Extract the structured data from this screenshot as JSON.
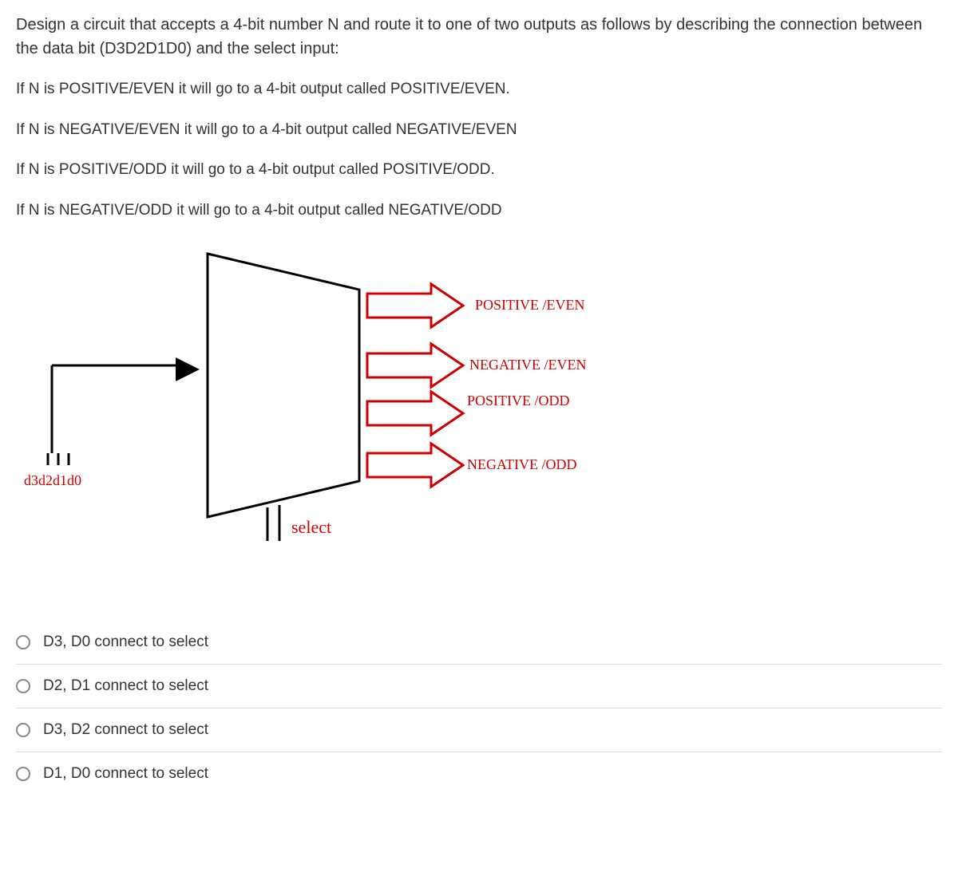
{
  "question": {
    "intro": "Design a circuit that accepts a 4-bit number N and route it to one of two outputs as follows by describing the connection between the data bit (D3D2D1D0) and the select input:",
    "conditions": [
      "If N is POSITIVE/EVEN it will go to a 4-bit output called POSITIVE/EVEN.",
      "If N is NEGATIVE/EVEN it will go to a 4-bit output called NEGATIVE/EVEN",
      "If N is POSITIVE/ODD it will go to a 4-bit output called POSITIVE/ODD.",
      "If N is NEGATIVE/ODD it will go to a 4-bit output called NEGATIVE/ODD"
    ]
  },
  "diagram": {
    "input_label": "d3d2d1d0",
    "select_label": "select",
    "outputs": [
      "POSITIVE /EVEN",
      "NEGATIVE /EVEN",
      "POSITIVE /ODD",
      "NEGATIVE /ODD"
    ]
  },
  "options": [
    "D3, D0 connect to select",
    "D2, D1 connect to select",
    "D3, D2 connect to select",
    "D1, D0 connect to select"
  ]
}
